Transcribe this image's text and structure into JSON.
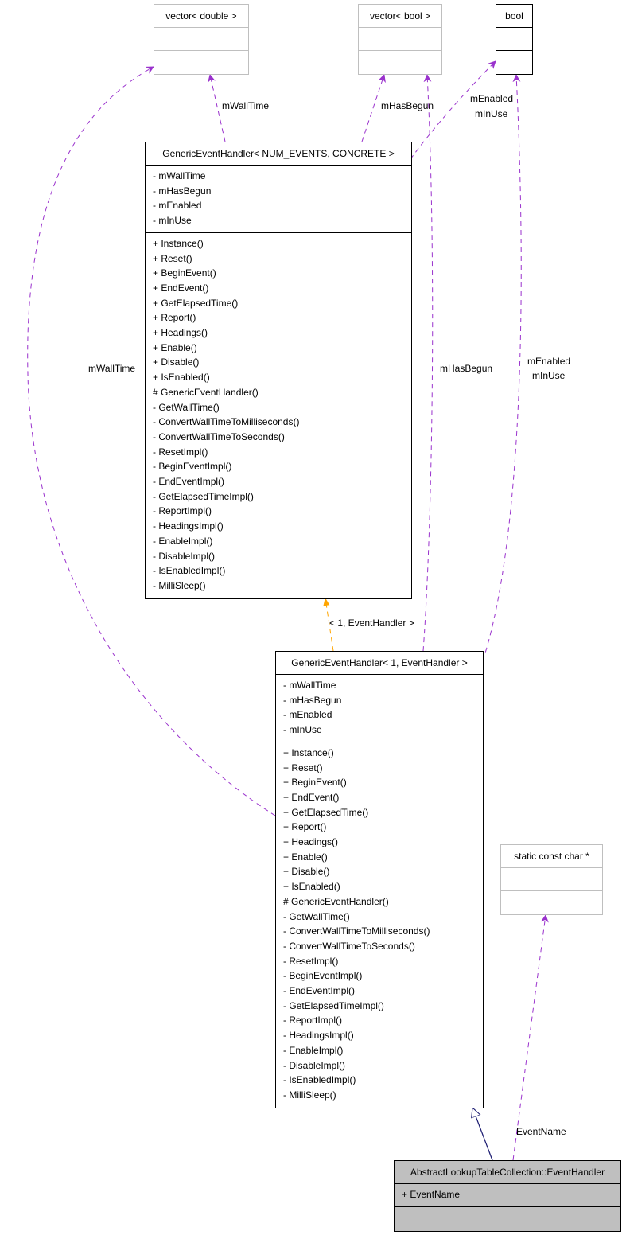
{
  "diagram": {
    "type": "uml-collaboration",
    "colors": {
      "member_edge": "#9a32cd",
      "template_edge": "#ffa500",
      "inheritance_edge": "#191970",
      "focus_fill": "#bfbfbf",
      "external_border": "#bfbfbf"
    },
    "nodes": {
      "vector_double": {
        "title": "vector< double >",
        "attributes": [],
        "methods": []
      },
      "vector_bool": {
        "title": "vector< bool >",
        "attributes": [],
        "methods": []
      },
      "bool": {
        "title": "bool",
        "attributes": [],
        "methods": []
      },
      "static_const_char": {
        "title": "static const char *",
        "attributes": [],
        "methods": []
      },
      "generic_template": {
        "title": "GenericEventHandler< NUM_EVENTS, CONCRETE >",
        "attributes": [
          "- mWallTime",
          "- mHasBegun",
          "- mEnabled",
          "- mInUse"
        ],
        "methods": [
          "+ Instance()",
          "+ Reset()",
          "+ BeginEvent()",
          "+ EndEvent()",
          "+ GetElapsedTime()",
          "+ Report()",
          "+ Headings()",
          "+ Enable()",
          "+ Disable()",
          "+ IsEnabled()",
          "# GenericEventHandler()",
          "- GetWallTime()",
          "- ConvertWallTimeToMilliseconds()",
          "- ConvertWallTimeToSeconds()",
          "- ResetImpl()",
          "- BeginEventImpl()",
          "- EndEventImpl()",
          "- GetElapsedTimeImpl()",
          "- ReportImpl()",
          "- HeadingsImpl()",
          "- EnableImpl()",
          "- DisableImpl()",
          "- IsEnabledImpl()",
          "- MilliSleep()"
        ]
      },
      "generic_instance": {
        "title": "GenericEventHandler< 1, EventHandler >",
        "attributes": [
          "- mWallTime",
          "- mHasBegun",
          "- mEnabled",
          "- mInUse"
        ],
        "methods": [
          "+ Instance()",
          "+ Reset()",
          "+ BeginEvent()",
          "+ EndEvent()",
          "+ GetElapsedTime()",
          "+ Report()",
          "+ Headings()",
          "+ Enable()",
          "+ Disable()",
          "+ IsEnabled()",
          "# GenericEventHandler()",
          "- GetWallTime()",
          "- ConvertWallTimeToMilliseconds()",
          "- ConvertWallTimeToSeconds()",
          "- ResetImpl()",
          "- BeginEventImpl()",
          "- EndEventImpl()",
          "- GetElapsedTimeImpl()",
          "- ReportImpl()",
          "- HeadingsImpl()",
          "- EnableImpl()",
          "- DisableImpl()",
          "- IsEnabledImpl()",
          "- MilliSleep()"
        ]
      },
      "event_handler": {
        "title": "AbstractLookupTableCollection::EventHandler",
        "attributes": [
          "+ EventName"
        ],
        "methods": []
      }
    },
    "edges": [
      {
        "from": "generic_template",
        "to": "vector_double",
        "kind": "member",
        "label": "mWallTime"
      },
      {
        "from": "generic_template",
        "to": "vector_bool",
        "kind": "member",
        "label": "mHasBegun"
      },
      {
        "from": "generic_template",
        "to": "bool",
        "kind": "member",
        "label": [
          "mEnabled",
          "mInUse"
        ]
      },
      {
        "from": "generic_instance",
        "to": "generic_template",
        "kind": "template",
        "label": "< 1, EventHandler >"
      },
      {
        "from": "generic_instance",
        "to": "vector_double",
        "kind": "member",
        "label": "mWallTime"
      },
      {
        "from": "generic_instance",
        "to": "vector_bool",
        "kind": "member",
        "label": "mHasBegun"
      },
      {
        "from": "generic_instance",
        "to": "bool",
        "kind": "member",
        "label": [
          "mEnabled",
          "mInUse"
        ]
      },
      {
        "from": "event_handler",
        "to": "generic_instance",
        "kind": "inheritance",
        "label": ""
      },
      {
        "from": "event_handler",
        "to": "static_const_char",
        "kind": "member",
        "label": "EventName"
      }
    ],
    "labels": {
      "e_template_walltime": "mWallTime",
      "e_template_hasbegun": "mHasBegun",
      "e_template_enabled": "mEnabled",
      "e_template_inuse": "mInUse",
      "e_instance_walltime": "mWallTime",
      "e_instance_hasbegun": "mHasBegun",
      "e_instance_enabled": "mEnabled",
      "e_instance_inuse": "mInUse",
      "e_template_args": "< 1, EventHandler >",
      "e_eventname": "EventName"
    }
  }
}
